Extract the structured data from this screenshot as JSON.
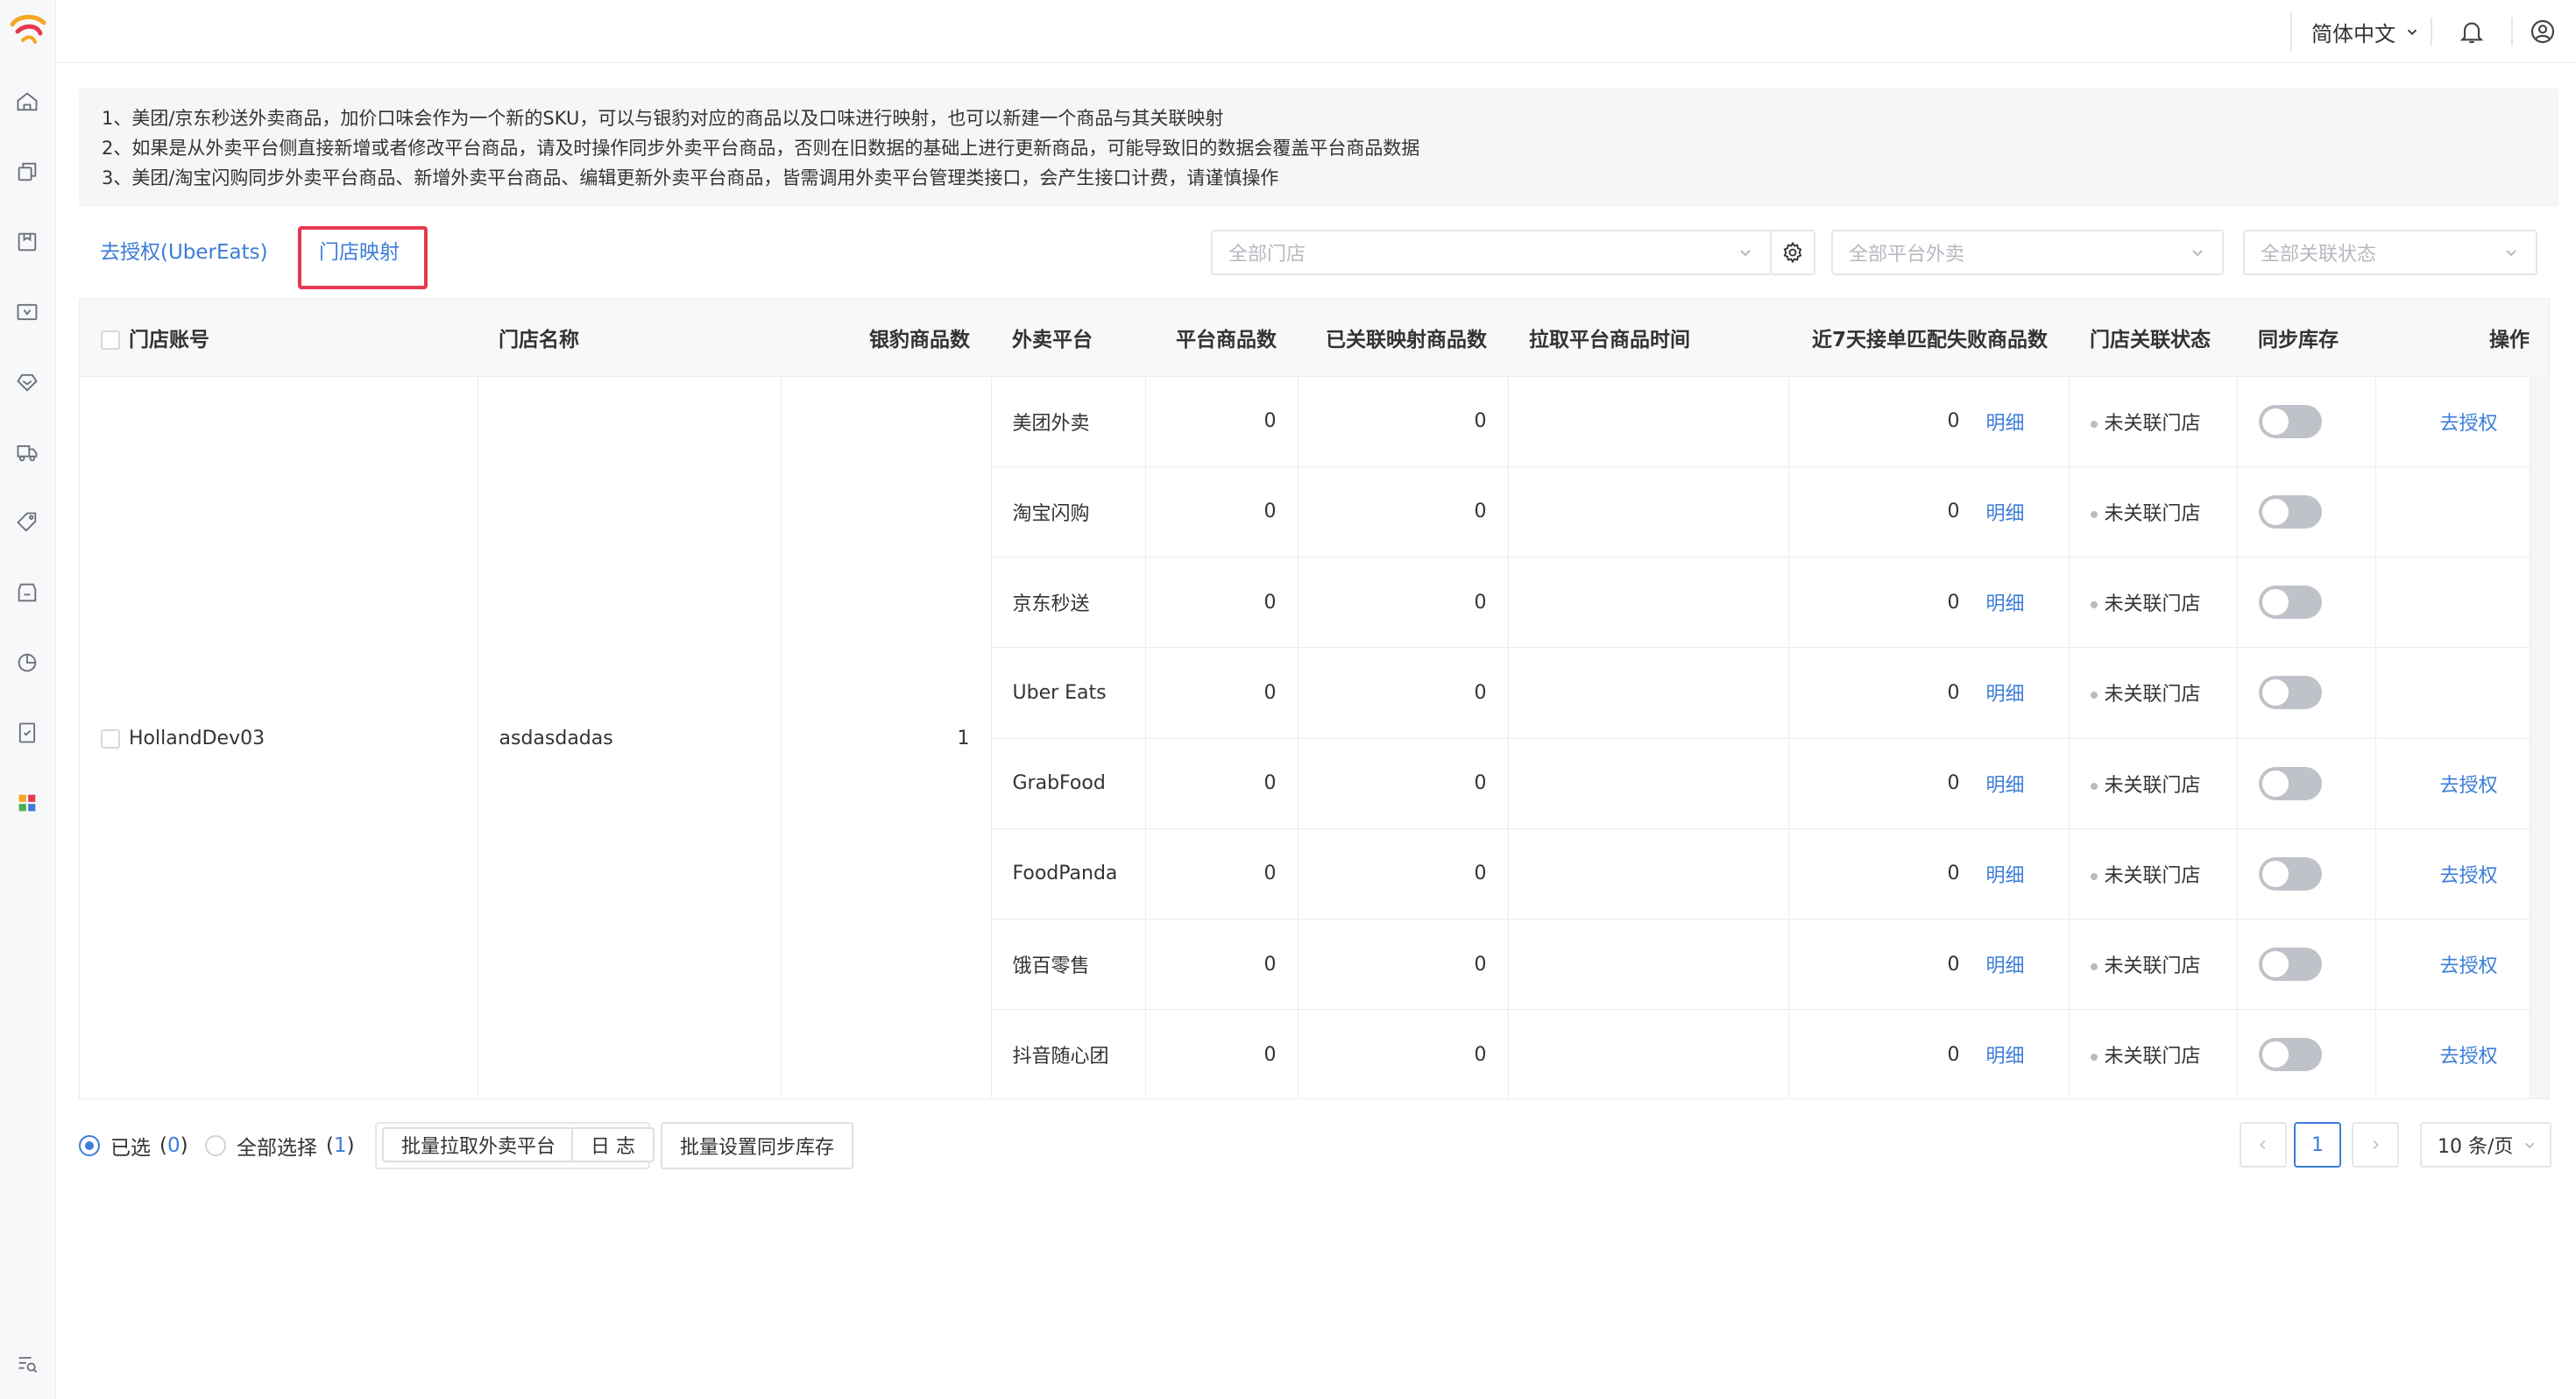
{
  "header": {
    "language": "简体中文"
  },
  "notice": {
    "lines": [
      "1、美团/京东秒送外卖商品，加价口味会作为一个新的SKU，可以与银豹对应的商品以及口味进行映射，也可以新建一个商品与其关联映射",
      "2、如果是从外卖平台侧直接新增或者修改平台商品，请及时操作同步外卖平台商品，否则在旧数据的基础上进行更新商品，可能导致旧的数据会覆盖平台商品数据",
      "3、美团/淘宝闪购同步外卖平台商品、新增外卖平台商品、编辑更新外卖平台商品，皆需调用外卖平台管理类接口，会产生接口计费，请谨慎操作"
    ]
  },
  "tabs": {
    "deauth_label": "去授权(UberEats)",
    "store_mapping_label": "门店映射"
  },
  "filters": {
    "store_placeholder": "全部门店",
    "platform_placeholder": "全部平台外卖",
    "status_placeholder": "全部关联状态"
  },
  "table": {
    "columns": [
      "门店账号",
      "门店名称",
      "银豹商品数",
      "外卖平台",
      "平台商品数",
      "已关联映射商品数",
      "拉取平台商品时间",
      "近7天接单匹配失败商品数",
      "门店关联状态",
      "同步库存",
      "操作"
    ],
    "store": {
      "account": "HollandDev03",
      "name": "asdasdadas",
      "product_count": "1"
    },
    "detail_label": "明细",
    "rows": [
      {
        "platform": "美团外卖",
        "platform_count": "0",
        "linked_count": "0",
        "fetch_time": "",
        "failed_count": "0",
        "status": "未关联门店",
        "action": "去授权"
      },
      {
        "platform": "淘宝闪购",
        "platform_count": "0",
        "linked_count": "0",
        "fetch_time": "",
        "failed_count": "0",
        "status": "未关联门店",
        "action": ""
      },
      {
        "platform": "京东秒送",
        "platform_count": "0",
        "linked_count": "0",
        "fetch_time": "",
        "failed_count": "0",
        "status": "未关联门店",
        "action": ""
      },
      {
        "platform": "Uber Eats",
        "platform_count": "0",
        "linked_count": "0",
        "fetch_time": "",
        "failed_count": "0",
        "status": "未关联门店",
        "action": ""
      },
      {
        "platform": "GrabFood",
        "platform_count": "0",
        "linked_count": "0",
        "fetch_time": "",
        "failed_count": "0",
        "status": "未关联门店",
        "action": "去授权"
      },
      {
        "platform": "FoodPanda",
        "platform_count": "0",
        "linked_count": "0",
        "fetch_time": "",
        "failed_count": "0",
        "status": "未关联门店",
        "action": "去授权"
      },
      {
        "platform": "饿百零售",
        "platform_count": "0",
        "linked_count": "0",
        "fetch_time": "",
        "failed_count": "0",
        "status": "未关联门店",
        "action": "去授权"
      },
      {
        "platform": "抖音随心团",
        "platform_count": "0",
        "linked_count": "0",
        "fetch_time": "",
        "failed_count": "0",
        "status": "未关联门店",
        "action": "去授权"
      }
    ]
  },
  "footer": {
    "selected_label": "已选",
    "selected_count": "0",
    "select_all_label": "全部选择",
    "select_all_count": "1",
    "batch_fetch_label": "批量拉取外卖平台",
    "log_label": "日 志",
    "batch_sync_label": "批量设置同步库存",
    "current_page": "1",
    "page_size": "10 条/页"
  },
  "colors": {
    "accent": "#3b7dd8",
    "highlight_box": "#e8384f"
  }
}
